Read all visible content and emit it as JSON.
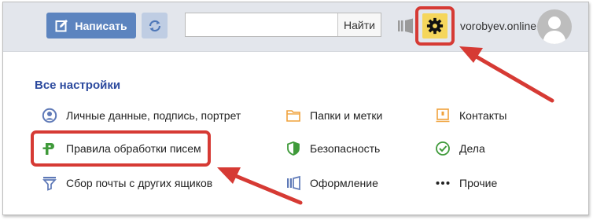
{
  "header": {
    "compose_label": "Написать",
    "search": {
      "value": "",
      "placeholder": "",
      "button_label": "Найти"
    },
    "user_name": "vorobyev.online"
  },
  "settings": {
    "title": "Все настройки",
    "items": [
      {
        "label": "Личные данные, подпись, портрет",
        "icon": "person-circle-icon"
      },
      {
        "label": "Папки и метки",
        "icon": "folder-icon"
      },
      {
        "label": "Контакты",
        "icon": "contacts-icon"
      },
      {
        "label": "Правила обработки писем",
        "icon": "rules-icon"
      },
      {
        "label": "Безопасность",
        "icon": "shield-icon"
      },
      {
        "label": "Дела",
        "icon": "checkmark-icon"
      },
      {
        "label": "Сбор почты с других ящиков",
        "icon": "funnel-icon"
      },
      {
        "label": "Оформление",
        "icon": "theme-icon"
      },
      {
        "label": "Прочие",
        "icon": "more-dots-icon"
      }
    ]
  },
  "colors": {
    "header_bg": "#e3e6ec",
    "compose_bg": "#5c84bf",
    "settings_button_bg": "#f5d65c",
    "title_color": "#2c4a9e",
    "highlight_red": "#d63a34"
  }
}
